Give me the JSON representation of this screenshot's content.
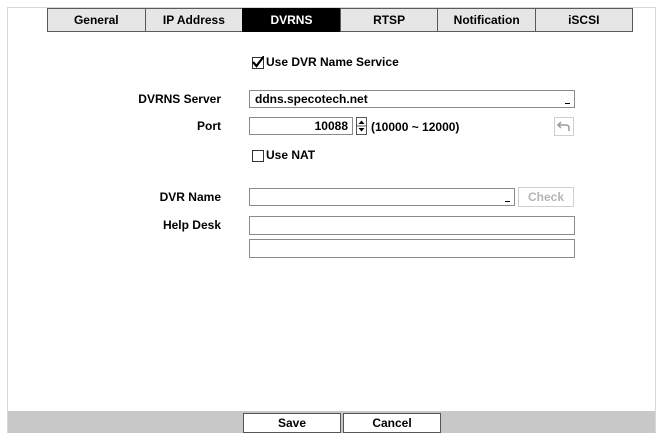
{
  "tabs": [
    {
      "label": "General"
    },
    {
      "label": "IP Address"
    },
    {
      "label": "DVRNS"
    },
    {
      "label": "RTSP"
    },
    {
      "label": "Notification"
    },
    {
      "label": "iSCSI"
    }
  ],
  "active_tab": "DVRNS",
  "use_dvrns": {
    "label": "Use DVR Name Service",
    "checked": true
  },
  "server": {
    "label": "DVRNS Server",
    "value": "ddns.specotech.net"
  },
  "port": {
    "label": "Port",
    "value": "10088",
    "range": "(10000 ~ 12000)"
  },
  "use_nat": {
    "label": "Use NAT",
    "checked": false
  },
  "dvr_name": {
    "label": "DVR Name",
    "value": "",
    "check_label": "Check"
  },
  "help_desk": {
    "label": "Help Desk",
    "line1": "",
    "line2": ""
  },
  "footer": {
    "save_label": "Save",
    "cancel_label": "Cancel"
  }
}
